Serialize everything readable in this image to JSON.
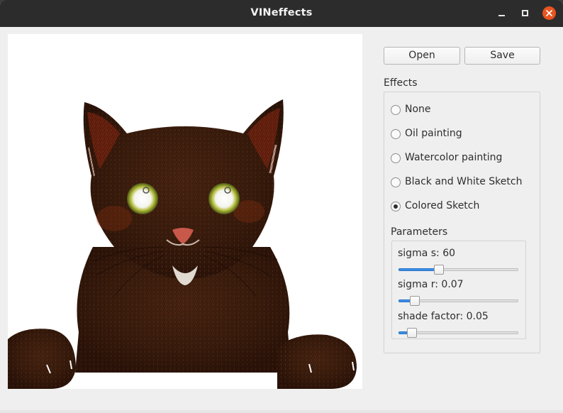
{
  "window": {
    "title": "VINeffects"
  },
  "toolbar": {
    "open_label": "Open",
    "save_label": "Save"
  },
  "effects": {
    "group_label": "Effects",
    "options": [
      {
        "label": "None",
        "checked": false
      },
      {
        "label": "Oil painting",
        "checked": false
      },
      {
        "label": "Watercolor painting",
        "checked": false
      },
      {
        "label": "Black and White Sketch",
        "checked": false
      },
      {
        "label": "Colored Sketch",
        "checked": true
      }
    ]
  },
  "parameters": {
    "group_label": "Parameters",
    "sliders": [
      {
        "label": "sigma s: 60",
        "level": 0.32
      },
      {
        "label": "sigma r: 0.07",
        "level": 0.1
      },
      {
        "label": "shade factor: 0.05",
        "level": 0.08
      }
    ]
  },
  "colors": {
    "titlebar": "#2c2c2c",
    "close_button": "#e95420",
    "slider_fill": "#3c8ee8"
  },
  "icons": [
    "minimize-icon",
    "maximize-icon",
    "close-icon"
  ]
}
